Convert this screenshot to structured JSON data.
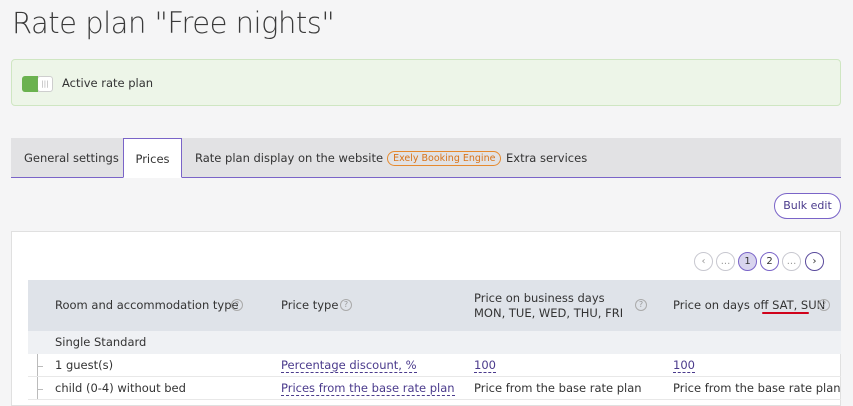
{
  "page_title": "Rate plan \"Free nights\"",
  "active_rate_plan": {
    "label": "Active rate plan",
    "enabled": true
  },
  "tabs": [
    {
      "label": "General settings",
      "active": false
    },
    {
      "label": "Prices",
      "active": true
    },
    {
      "label": "Rate plan display on the website",
      "badge": "Exely Booking Engine",
      "active": false
    },
    {
      "label": "Extra services",
      "active": false
    }
  ],
  "bulk_edit_label": "Bulk edit",
  "pagination": {
    "prev": "‹",
    "ellipsis_left": "...",
    "pages": [
      "1",
      "2"
    ],
    "current": "1",
    "ellipsis_right": "...",
    "next": "›"
  },
  "table": {
    "columns": [
      "Room and accommodation type",
      "Price type",
      "Price on business days MON, TUE, WED, THU, FRI",
      "Price on days off "
    ],
    "days_off_highlight": "SAT, SUN",
    "help_icon": "?",
    "group": "Single Standard",
    "rows": [
      {
        "room": "1 guest(s)",
        "price_type": "Percentage discount, %",
        "business": "100",
        "days_off": "100",
        "linked_values": true
      },
      {
        "room": "child (0-4) without bed",
        "price_type": "Prices from the base rate plan",
        "business": "Price from the base rate plan",
        "days_off": "Price from the base rate plan",
        "linked_values": false
      }
    ]
  },
  "colors": {
    "accent": "#7a64c8",
    "active_bg": "#edf5e8",
    "toggle_on": "#6bb24f",
    "badge": "#e68a2e",
    "red_underline": "#d0021b"
  }
}
